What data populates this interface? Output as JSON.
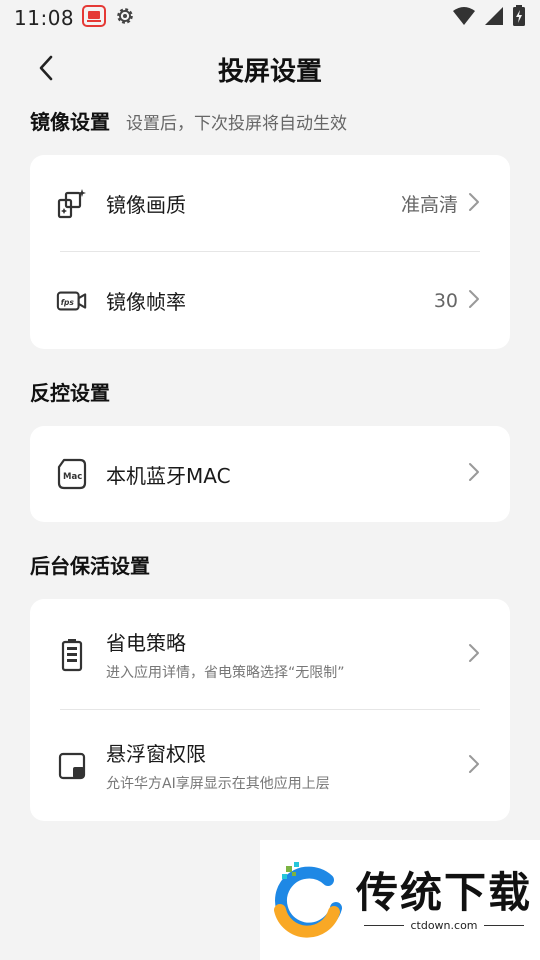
{
  "status_bar": {
    "time": "11:08",
    "icons_left": [
      "cast-icon",
      "gear-icon"
    ],
    "icons_right": [
      "wifi-icon",
      "signal-icon",
      "battery-charging-icon"
    ]
  },
  "header": {
    "title": "投屏设置"
  },
  "sections": {
    "mirror": {
      "title": "镜像设置",
      "subtitle": "设置后，下次投屏将自动生效",
      "items": [
        {
          "label": "镜像画质",
          "value": "准高清",
          "icon": "mirror-quality-icon"
        },
        {
          "label": "镜像帧率",
          "value": "30",
          "icon": "fps-icon"
        }
      ]
    },
    "control": {
      "title": "反控设置",
      "items": [
        {
          "label": "本机蓝牙MAC",
          "icon": "mac-icon"
        }
      ]
    },
    "background": {
      "title": "后台保活设置",
      "items": [
        {
          "label": "省电策略",
          "desc": "进入应用详情，省电策略选择“无限制”",
          "icon": "battery-icon"
        },
        {
          "label": "悬浮窗权限",
          "desc": "允许华方AI享屏显示在其他应用上层",
          "icon": "floating-window-icon"
        }
      ]
    }
  },
  "watermark": {
    "title": "传统下载",
    "url": "ctdown.com"
  },
  "colors": {
    "background": "#f3f3f3",
    "card": "#ffffff",
    "cast_icon": "#e53935"
  }
}
